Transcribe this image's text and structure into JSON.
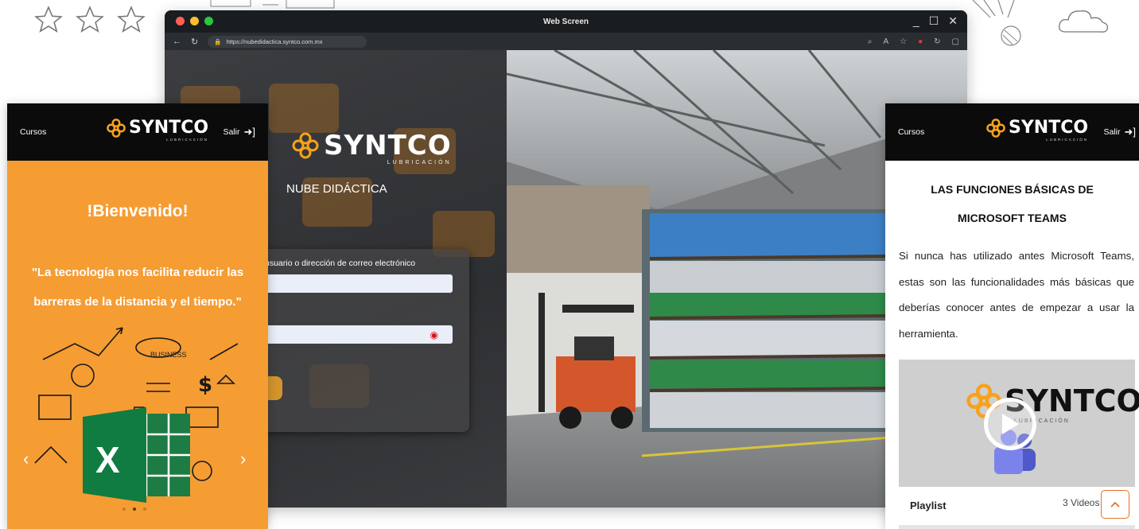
{
  "browser": {
    "window_title": "Web Screen",
    "url": "https://nubedidactica.syntco.com.mx",
    "traffic_colors": [
      "#ff5f57",
      "#febc2e",
      "#28c840"
    ],
    "controls": [
      "_",
      "☐",
      "✕"
    ]
  },
  "login": {
    "brand": "SYNTCO",
    "brand_sub": "LUBRICACIÓN",
    "site_title": "NUBE DIDÁCTICA",
    "username_label": "usuario o dirección de correo electrónico",
    "username_value": "",
    "password_value": ""
  },
  "phone_left": {
    "nav_left": "Cursos",
    "nav_right": "Salir",
    "brand": "SYNTCO",
    "brand_sub": "LUBRICACIÓN",
    "welcome": "!Bienvenido!",
    "quote": "\"La tecnología nos facilita reducir las barreras de la distancia y el tiempo.\"",
    "prev_arrow": "‹",
    "next_arrow": "›"
  },
  "phone_right": {
    "nav_left": "Cursos",
    "nav_right": "Salir",
    "brand": "SYNTCO",
    "brand_sub": "LUBRICACIÓN",
    "title_line1": "LAS FUNCIONES BÁSICAS DE",
    "title_line2": "MICROSOFT TEAMS",
    "body": "Si nunca has utilizado antes Microsoft Teams, estas son las funcionalidades más básicas que deberías conocer antes de empezar a usar la herramienta.",
    "video_brand": "SYNTCO",
    "video_brand_sub": "LUBRICACIÓN",
    "playlist_label": "Playlist",
    "videos_count": "3 Videos"
  },
  "colors": {
    "accent_orange": "#f59c33",
    "brand_orange": "#f7a21b",
    "scroll_top": "#e8712a"
  },
  "icons": [
    "star-icon",
    "cloud-icon",
    "user-group-icon",
    "graduation-cap-icon",
    "chart-icon",
    "book-icon",
    "folder-icon",
    "eye-icon",
    "sign-out-icon",
    "play-icon",
    "chevron-up-icon"
  ]
}
